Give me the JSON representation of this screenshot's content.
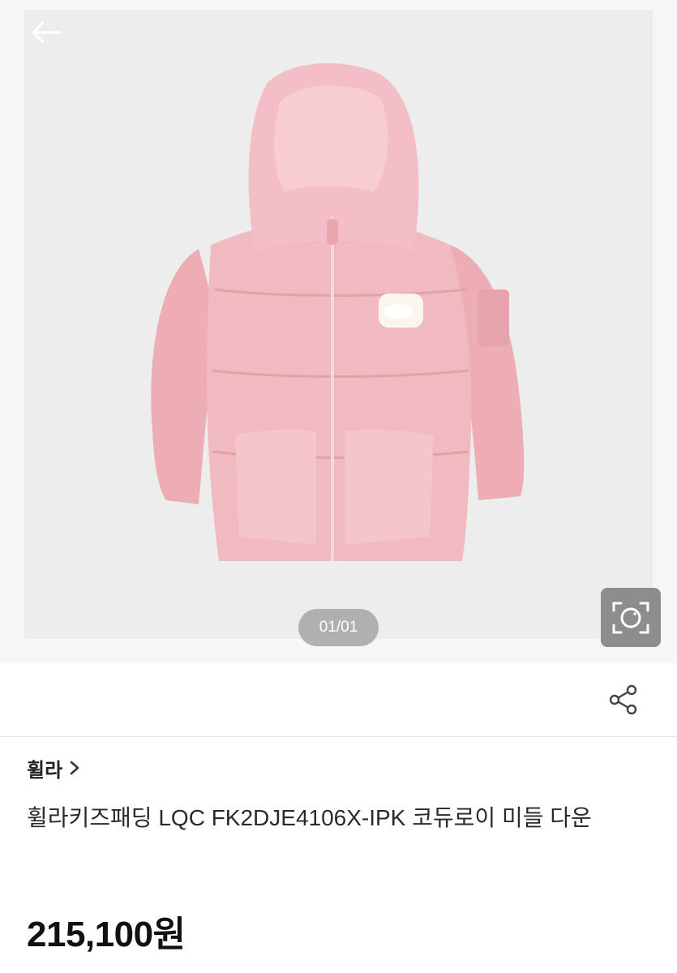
{
  "gallery": {
    "image_label": "pink hooded kids puffer jacket with polar bear patch",
    "counter": "01/01"
  },
  "icons": {
    "back": "back-arrow-icon",
    "lens": "camera-search-icon",
    "share": "share-icon",
    "brand_chevron": "chevron-right-icon"
  },
  "brand": {
    "name": "휠라"
  },
  "product": {
    "title": "휠라키즈패딩 LQC FK2DJE4106X-IPK 코듀로이 미들 다운",
    "price": "215,100원"
  },
  "colors": {
    "jacket_pink": "#f1b9c0",
    "hero_bg": "#ededed",
    "badge_bg": "#a5a5a5"
  }
}
